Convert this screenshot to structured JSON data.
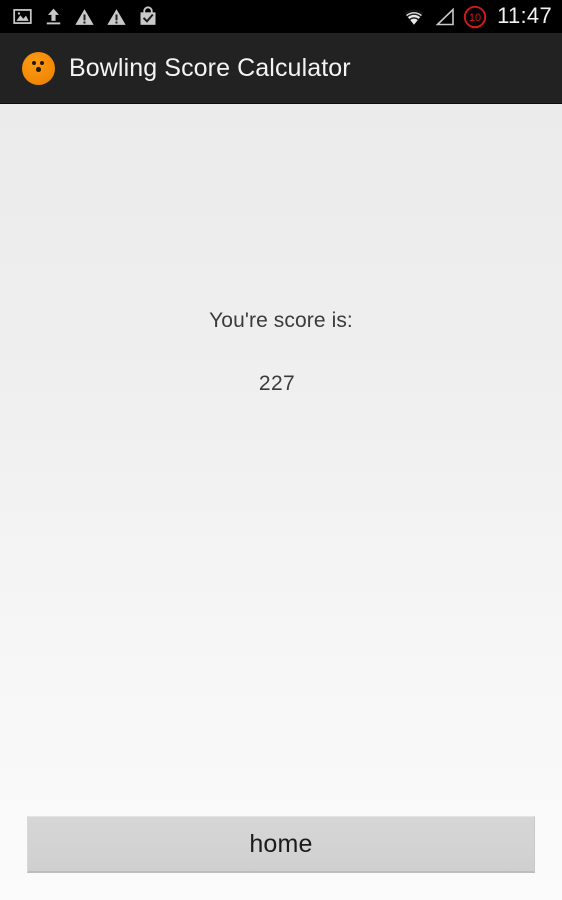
{
  "status_bar": {
    "background_color": "#000000",
    "time": "11:47",
    "battery_level": "10",
    "left_icons": [
      {
        "name": "photo-icon"
      },
      {
        "name": "upload-icon"
      },
      {
        "name": "warning-triangle-icon"
      },
      {
        "name": "warning-triangle-icon"
      },
      {
        "name": "shopping-bag-check-icon"
      }
    ],
    "right_icons": [
      {
        "name": "wifi-icon"
      },
      {
        "name": "cellular-signal-icon"
      },
      {
        "name": "battery-icon"
      }
    ]
  },
  "action_bar": {
    "background_color": "#222222",
    "app_icon_name": "bowling-ball-icon",
    "app_icon_color": "#f58b06",
    "title": "Bowling Score Calculator"
  },
  "content": {
    "background_top_color": "#ebebeb",
    "background_bottom_color": "#fbfbfb",
    "score_label": "You're score is:",
    "score_value": "227"
  },
  "footer": {
    "home_button_label": "home",
    "home_button_color": "#d3d3d3"
  }
}
